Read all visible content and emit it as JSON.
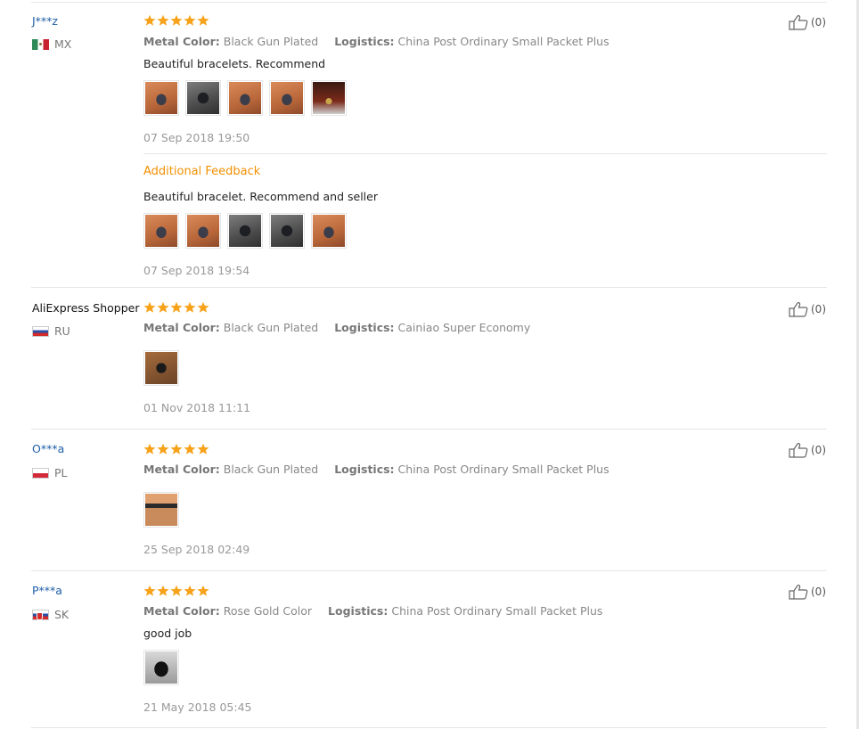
{
  "reviews": [
    {
      "user": "J***z",
      "country": "MX",
      "color_label": "Metal Color:",
      "color_value": "Black Gun Plated",
      "logistics_label": "Logistics:",
      "logistics_value": "China Post Ordinary Small Packet Plus",
      "text": "Beautiful bracelets. Recommend",
      "date": "07 Sep 2018 19:50",
      "likes": "(0)",
      "rating": 5,
      "additional": {
        "label": "Additional Feedback",
        "text": "Beautiful bracelet. Recommend and seller",
        "date": "07 Sep 2018 19:54"
      }
    },
    {
      "user": "AliExpress Shopper",
      "country": "RU",
      "color_label": "Metal Color:",
      "color_value": "Black Gun Plated",
      "logistics_label": "Logistics:",
      "logistics_value": "Cainiao Super Economy",
      "text": "",
      "date": "01 Nov 2018 11:11",
      "likes": "(0)",
      "rating": 5
    },
    {
      "user": "O***a",
      "country": "PL",
      "color_label": "Metal Color:",
      "color_value": "Black Gun Plated",
      "logistics_label": "Logistics:",
      "logistics_value": "China Post Ordinary Small Packet Plus",
      "text": "",
      "date": "25 Sep 2018 02:49",
      "likes": "(0)",
      "rating": 5
    },
    {
      "user": "P***a",
      "country": "SK",
      "color_label": "Metal Color:",
      "color_value": "Rose Gold Color",
      "logistics_label": "Logistics:",
      "logistics_value": "China Post Ordinary Small Packet Plus",
      "text": "good job",
      "date": "21 May 2018 05:45",
      "likes": "(0)",
      "rating": 5
    }
  ],
  "colors": {
    "star": "#f7a21b",
    "link": "#1f5fa8",
    "additional_feedback": "#f29000"
  }
}
